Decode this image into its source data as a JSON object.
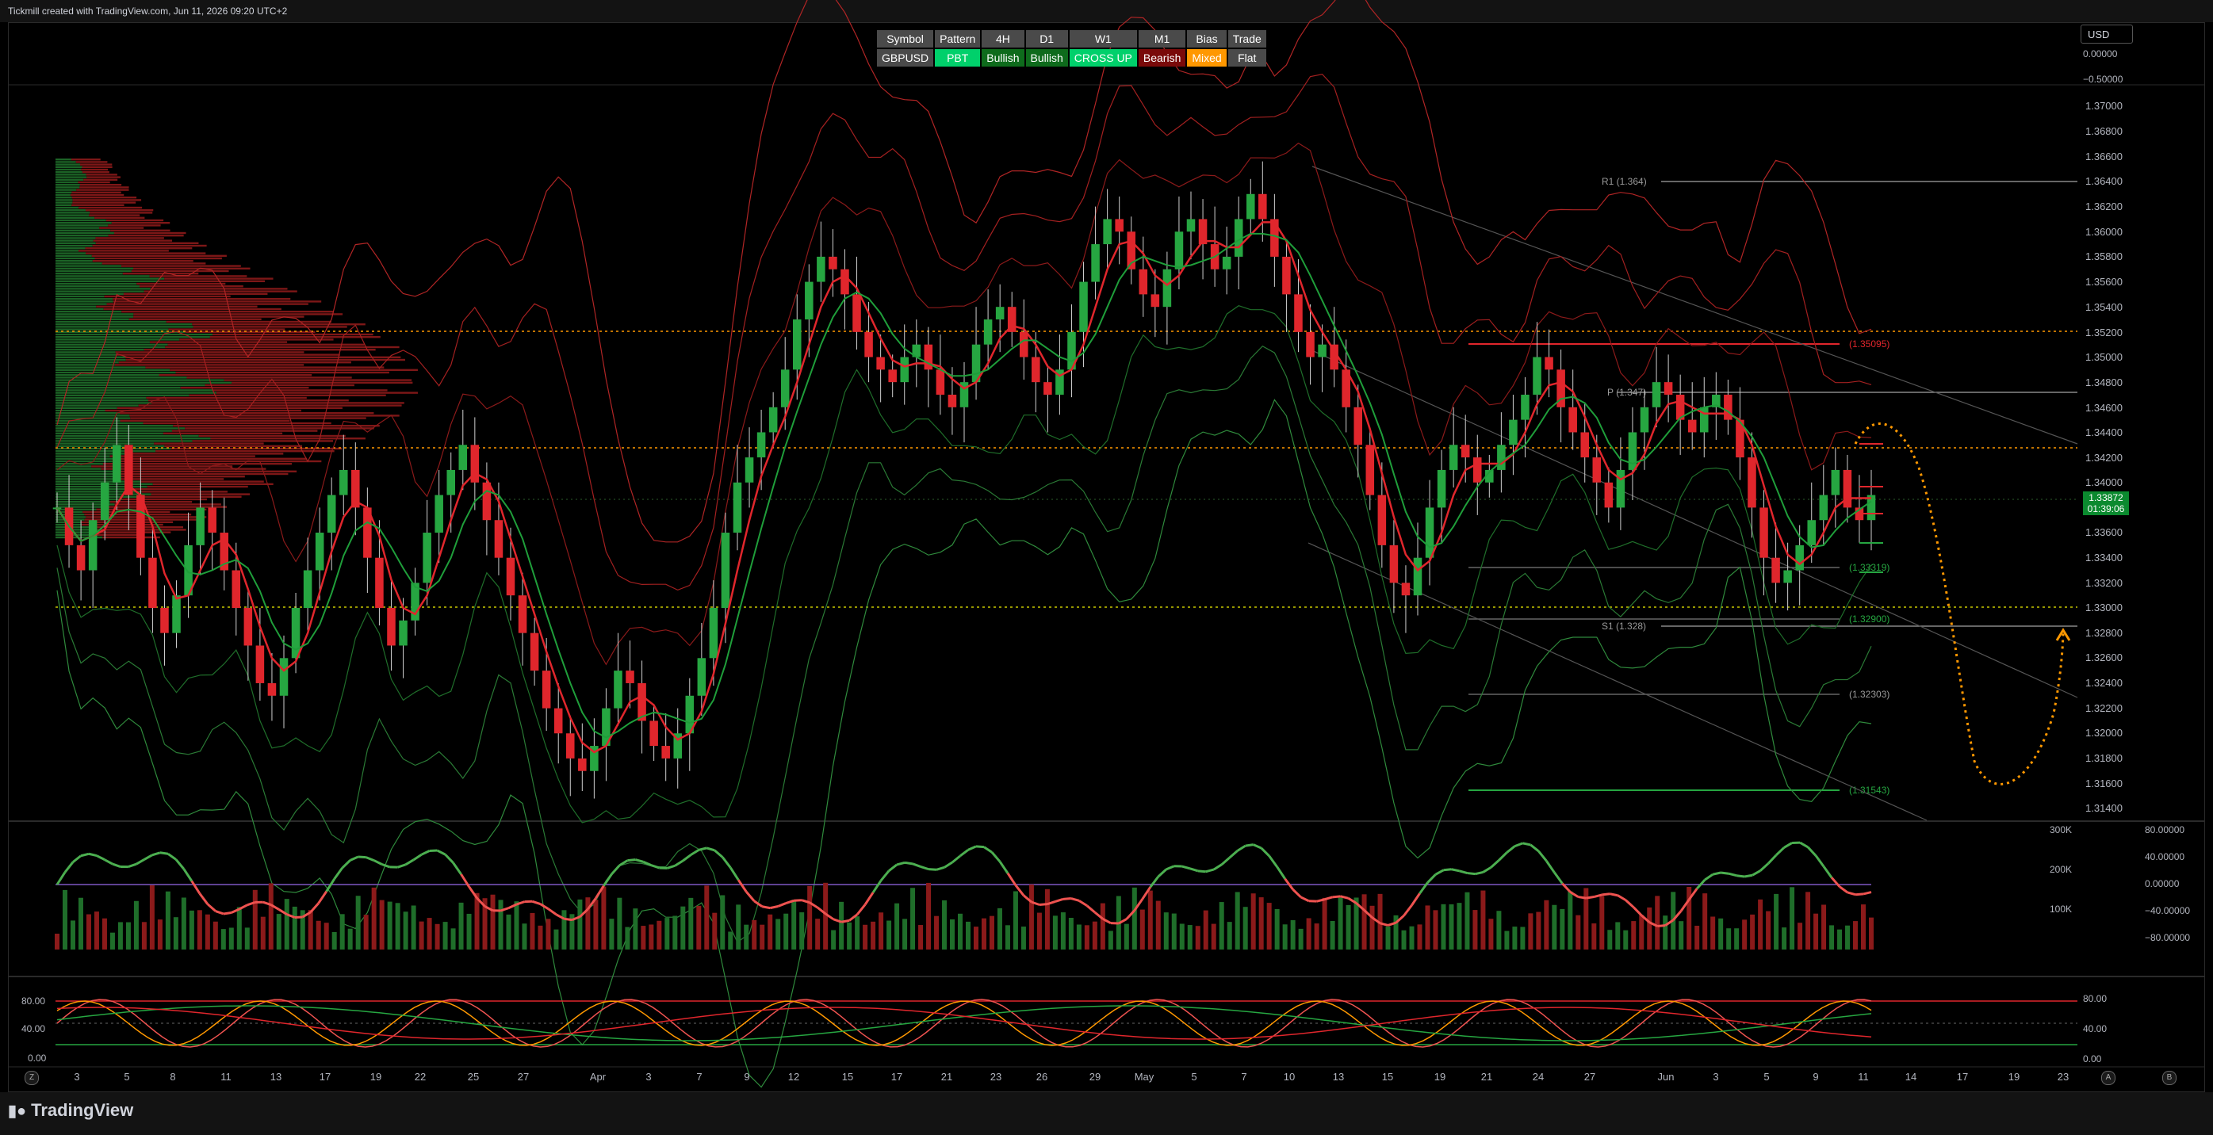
{
  "header": {
    "credit": "Tickmill created with TradingView.com, Jun 11, 2026 09:20 UTC+2"
  },
  "summary_table": {
    "headers": [
      "Symbol",
      "Pattern",
      "4H",
      "D1",
      "W1",
      "M1",
      "Bias",
      "Trade"
    ],
    "values": [
      "GBPUSD",
      "PBT",
      "Bullish",
      "Bullish",
      "CROSS UP",
      "Bearish",
      "Mixed",
      "Flat"
    ]
  },
  "currency": "USD",
  "price_axis": {
    "labels": [
      "1.37000",
      "1.36800",
      "1.36600",
      "1.36400",
      "1.36200",
      "1.36000",
      "1.35800",
      "1.35600",
      "1.35400",
      "1.35200",
      "1.35000",
      "1.34800",
      "1.34600",
      "1.34400",
      "1.34200",
      "1.34000",
      "1.33600",
      "1.33400",
      "1.33200",
      "1.33000",
      "1.32800",
      "1.32600",
      "1.32400",
      "1.32200",
      "1.32000",
      "1.31800",
      "1.31600",
      "1.31400"
    ],
    "top_labels": [
      "0.00000",
      "−0.50000"
    ]
  },
  "last_price": {
    "price": "1.33872",
    "countdown": "01:39:06"
  },
  "levels": [
    {
      "label": "R1 (1.364)"
    },
    {
      "label": "P (1.347)"
    },
    {
      "label": "S1 (1.328)"
    },
    {
      "label": "(1.35095)"
    },
    {
      "label": "(1.33319)"
    },
    {
      "label": "(1.32900)"
    },
    {
      "label": "(1.32303)"
    },
    {
      "label": "(1.31543)"
    }
  ],
  "volume_axis": {
    "labels": [
      "300K",
      "200K",
      "100K"
    ]
  },
  "osc1_axis": {
    "labels": [
      "80.00000",
      "40.00000",
      "0.00000",
      "−40.00000",
      "−80.00000"
    ]
  },
  "osc2_axis": {
    "left": [
      "80.00",
      "40.00",
      "0.00"
    ],
    "right": [
      "80.00",
      "40.00",
      "0.00"
    ]
  },
  "time_axis": {
    "labels": [
      "3",
      "5",
      "8",
      "11",
      "13",
      "17",
      "19",
      "22",
      "25",
      "27",
      "Apr",
      "3",
      "7",
      "9",
      "12",
      "15",
      "17",
      "21",
      "23",
      "26",
      "29",
      "May",
      "5",
      "7",
      "10",
      "13",
      "15",
      "19",
      "21",
      "24",
      "27",
      "Jun",
      "3",
      "5",
      "9",
      "11",
      "14",
      "17",
      "19",
      "23"
    ]
  },
  "footer": {
    "logo": "TradingView",
    "scale_z": "Z",
    "scale_a": "A",
    "scale_b": "B"
  },
  "colors": {
    "bull": "#26a641",
    "bear": "#e0262c",
    "bg": "#000000",
    "orange": "#ff9800"
  },
  "chart_data": {
    "type": "candlestick",
    "symbol": "GBPUSD",
    "ylim": [
      1.314,
      1.372
    ],
    "close_series": [
      1.338,
      1.335,
      1.333,
      1.337,
      1.34,
      1.343,
      1.339,
      1.334,
      1.33,
      1.328,
      1.331,
      1.335,
      1.338,
      1.336,
      1.333,
      1.33,
      1.327,
      1.324,
      1.323,
      1.326,
      1.33,
      1.333,
      1.336,
      1.339,
      1.341,
      1.338,
      1.334,
      1.33,
      1.327,
      1.329,
      1.332,
      1.336,
      1.339,
      1.341,
      1.343,
      1.34,
      1.337,
      1.334,
      1.331,
      1.328,
      1.325,
      1.322,
      1.32,
      1.318,
      1.317,
      1.319,
      1.322,
      1.325,
      1.324,
      1.321,
      1.319,
      1.318,
      1.32,
      1.323,
      1.326,
      1.33,
      1.336,
      1.34,
      1.342,
      1.344,
      1.346,
      1.349,
      1.353,
      1.356,
      1.358,
      1.357,
      1.355,
      1.352,
      1.35,
      1.349,
      1.348,
      1.35,
      1.351,
      1.349,
      1.347,
      1.346,
      1.348,
      1.351,
      1.353,
      1.354,
      1.352,
      1.35,
      1.348,
      1.347,
      1.349,
      1.352,
      1.356,
      1.359,
      1.361,
      1.36,
      1.357,
      1.355,
      1.354,
      1.357,
      1.36,
      1.361,
      1.359,
      1.357,
      1.358,
      1.361,
      1.363,
      1.361,
      1.358,
      1.355,
      1.352,
      1.35,
      1.351,
      1.349,
      1.346,
      1.343,
      1.339,
      1.335,
      1.332,
      1.331,
      1.334,
      1.338,
      1.341,
      1.343,
      1.342,
      1.34,
      1.341,
      1.343,
      1.345,
      1.347,
      1.35,
      1.349,
      1.346,
      1.344,
      1.342,
      1.34,
      1.338,
      1.341,
      1.344,
      1.346,
      1.348,
      1.347,
      1.345,
      1.344,
      1.346,
      1.347,
      1.345,
      1.342,
      1.338,
      1.334,
      1.332,
      1.333,
      1.335,
      1.337,
      1.339,
      1.341,
      1.338,
      1.337,
      1.339
    ]
  }
}
